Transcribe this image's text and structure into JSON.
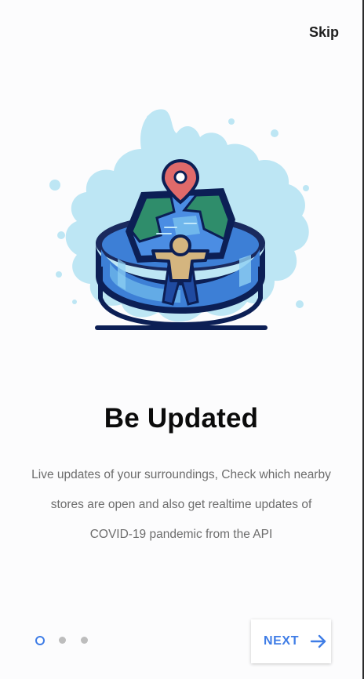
{
  "header": {
    "skip_label": "Skip"
  },
  "onboarding": {
    "title": "Be Updated",
    "description": "Live updates of your surroundings, Check which nearby stores are open and also get realtime updates of COVID-19 pandemic from the API",
    "illustration_icon": "map-location-person-icon"
  },
  "pager": {
    "total_pages": 3,
    "current_page": 1
  },
  "footer": {
    "next_label": "NEXT",
    "next_icon": "arrow-right-icon"
  },
  "colors": {
    "accent": "#3f7de6",
    "title": "#0b0b0b",
    "body_text": "#6d6d6d",
    "inactive_dot": "#bdbdbd",
    "pin": "#e06a6a",
    "splash": "#bde6f4"
  }
}
